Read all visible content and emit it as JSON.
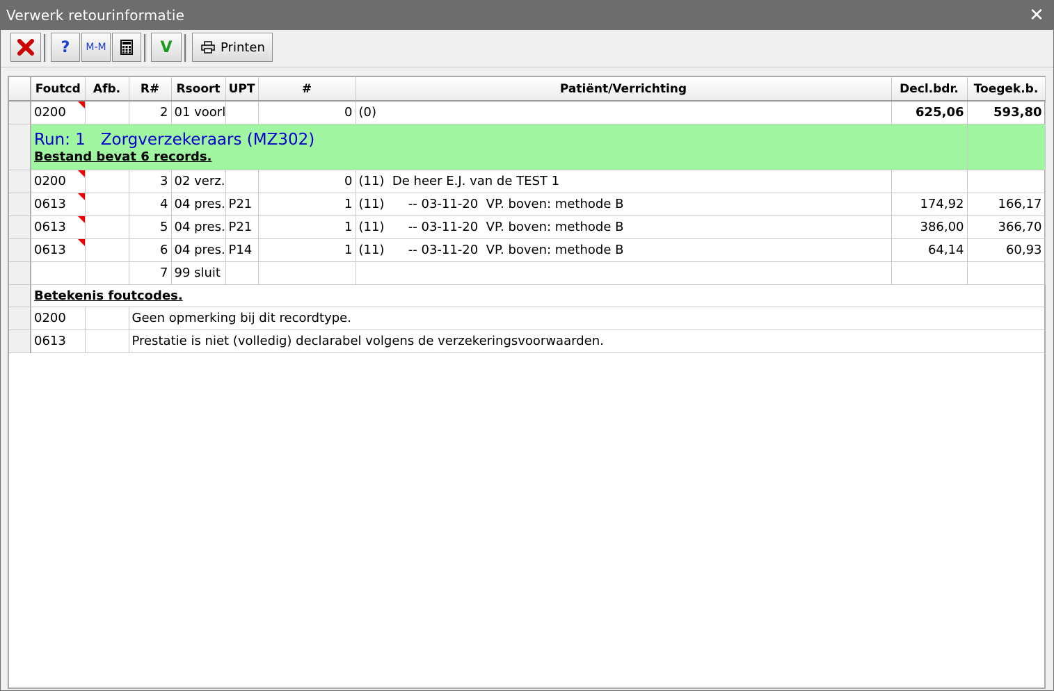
{
  "window": {
    "title": "Verwerk retourinformatie",
    "close_glyph": "✕"
  },
  "toolbar": {
    "cancel_icon": "red-x-icon",
    "help_label": "?",
    "mm_label": "M-M",
    "calc_icon": "calculator-icon",
    "ok_label": "V",
    "print_label": "Printen",
    "colors": {
      "cancel": "#cc0000",
      "help": "#1a3ad6",
      "ok": "#1c9a1c"
    }
  },
  "grid": {
    "columns": [
      "Foutcd",
      "Afb.",
      "R#",
      "Rsoort",
      "UPT",
      "#",
      "Patiënt/Verrichting",
      "Decl.bdr.",
      "Toegek.b."
    ],
    "rows": [
      {
        "foutcd": "0200",
        "afb": "",
        "r": "2",
        "rsoort": "01 voorl",
        "upt": "",
        "count": "0",
        "patient": "(0)",
        "decl": "625,06",
        "toegek": "593,80"
      },
      {
        "foutcd": "0200",
        "afb": "",
        "r": "3",
        "rsoort": "02 verz.",
        "upt": "",
        "count": "0",
        "patient": "(11)  De heer E.J. van de TEST 1",
        "decl": "",
        "toegek": ""
      },
      {
        "foutcd": "0613",
        "afb": "",
        "r": "4",
        "rsoort": "04 pres.",
        "upt": "P21",
        "count": "1",
        "patient": "(11)      -- 03-11-20  VP. boven: methode B",
        "decl": "174,92",
        "toegek": "166,17"
      },
      {
        "foutcd": "0613",
        "afb": "",
        "r": "5",
        "rsoort": "04 pres.",
        "upt": "P21",
        "count": "1",
        "patient": "(11)      -- 03-11-20  VP. boven: methode B",
        "decl": "386,00",
        "toegek": "366,70"
      },
      {
        "foutcd": "0613",
        "afb": "",
        "r": "6",
        "rsoort": "04 pres.",
        "upt": "P14",
        "count": "1",
        "patient": "(11)      -- 03-11-20  VP. boven: methode B",
        "decl": "64,14",
        "toegek": "60,93"
      },
      {
        "foutcd": "",
        "afb": "",
        "r": "7",
        "rsoort": "99 sluit",
        "upt": "",
        "count": "",
        "patient": "",
        "decl": "",
        "toegek": ""
      }
    ],
    "run": {
      "label": "Run: 1",
      "name": "Zorgverzekeraars (MZ302)",
      "note": "Bestand bevat 6 records."
    },
    "meaning_heading": "Betekenis foutcodes.",
    "codes": [
      {
        "code": "0200",
        "text": "Geen opmerking bij dit recordtype."
      },
      {
        "code": "0613",
        "text": "Prestatie is niet (volledig) declarabel volgens de verzekeringsvoorwaarden."
      }
    ],
    "colors": {
      "run_bg": "#a0f5a0",
      "run_text": "#0000cc",
      "flag": "#ee0000"
    }
  }
}
